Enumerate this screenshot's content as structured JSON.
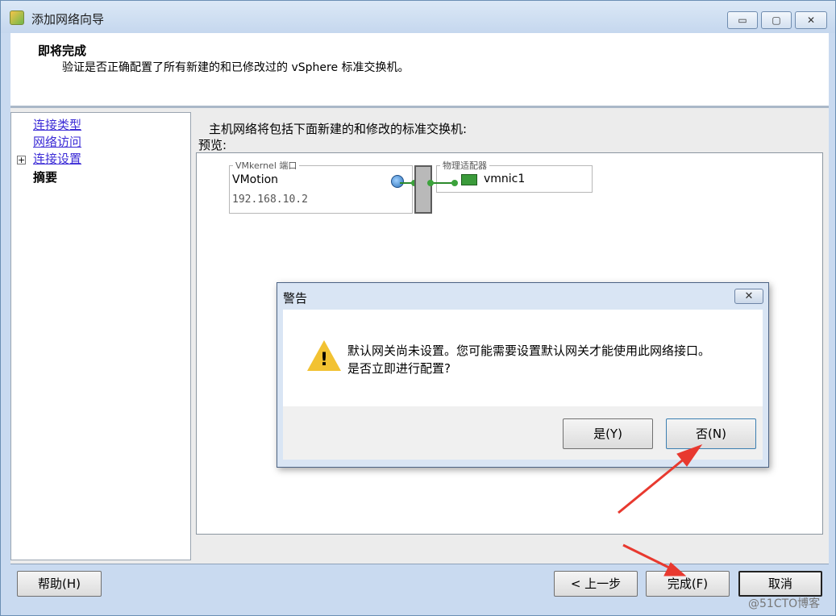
{
  "window": {
    "title": "添加网络向导",
    "minimize": "▭",
    "maximize": "▢",
    "close": "✕"
  },
  "header": {
    "title": "即将完成",
    "subtitle": "验证是否正确配置了所有新建的和已修改过的 vSphere 标准交换机。"
  },
  "nav": {
    "items": [
      {
        "label": "连接类型"
      },
      {
        "label": "网络访问"
      },
      {
        "label": "连接设置"
      },
      {
        "label": "摘要"
      }
    ],
    "expander": "+"
  },
  "content": {
    "title": "主机网络将包括下面新建的和修改的标准交换机:",
    "preview_label": "预览:",
    "vmkernel": {
      "legend": "VMkernel 端口",
      "name": "VMotion",
      "ip": "192.168.10.2"
    },
    "adapter": {
      "legend": "物理适配器",
      "name": "vmnic1"
    }
  },
  "footer": {
    "help": "帮助(H)",
    "back": "< 上一步",
    "finish": "完成(F)",
    "cancel": "取消"
  },
  "dialog": {
    "title": "警告",
    "close": "✕",
    "message_line1": "默认网关尚未设置。您可能需要设置默认网关才能使用此网络接口。",
    "message_line2": "是否立即进行配置?",
    "yes": "是(Y)",
    "no": "否(N)",
    "warning_mark": "!"
  },
  "watermark": "@51CTO博客",
  "colors": {
    "link": "#3b2bd6",
    "arrow": "#e8392f",
    "warning": "#f2c232"
  }
}
